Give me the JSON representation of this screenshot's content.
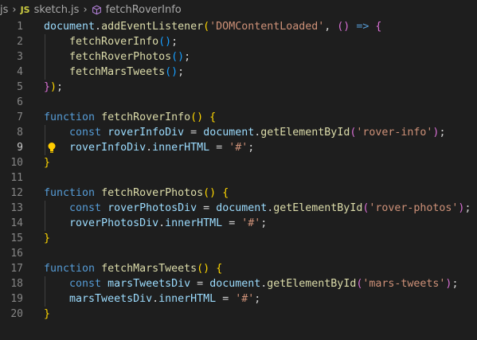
{
  "breadcrumb": {
    "folder": "js",
    "file_badge": "JS",
    "file": "sketch.js",
    "symbol": "fetchRoverInfo",
    "separator_icon": "chevron-right-icon",
    "symbol_icon": "method-cube-icon"
  },
  "editor": {
    "active_line": 9,
    "colors": {
      "background": "#1e1e1e",
      "keyword": "#569cd6",
      "function": "#dcdcaa",
      "variable": "#9cdcfe",
      "string": "#ce9178",
      "bracket_gold": "#ffd700",
      "bracket_orchid": "#da70d6",
      "bracket_blue": "#179fff"
    },
    "lines": [
      {
        "n": "1",
        "t": [
          [
            "var",
            "document"
          ],
          [
            "pun",
            "."
          ],
          [
            "fn",
            "addEventListener"
          ],
          [
            "br1",
            "("
          ],
          [
            "str",
            "'DOMContentLoaded'"
          ],
          [
            "pun",
            ", "
          ],
          [
            "br2",
            "()"
          ],
          [
            "kw",
            " => "
          ],
          [
            "br2",
            "{"
          ]
        ]
      },
      {
        "n": "2",
        "t": [
          [
            "pun",
            "    "
          ],
          [
            "fn",
            "fetchRoverInfo"
          ],
          [
            "br3",
            "()"
          ],
          [
            "pun",
            ";"
          ]
        ]
      },
      {
        "n": "3",
        "t": [
          [
            "pun",
            "    "
          ],
          [
            "fn",
            "fetchRoverPhotos"
          ],
          [
            "br3",
            "()"
          ],
          [
            "pun",
            ";"
          ]
        ]
      },
      {
        "n": "4",
        "t": [
          [
            "pun",
            "    "
          ],
          [
            "fn",
            "fetchMarsTweets"
          ],
          [
            "br3",
            "()"
          ],
          [
            "pun",
            ";"
          ]
        ]
      },
      {
        "n": "5",
        "t": [
          [
            "br2",
            "}"
          ],
          [
            "br1",
            ")"
          ],
          [
            "pun",
            ";"
          ]
        ]
      },
      {
        "n": "6",
        "t": []
      },
      {
        "n": "7",
        "t": [
          [
            "kw",
            "function"
          ],
          [
            "pun",
            " "
          ],
          [
            "fn",
            "fetchRoverInfo"
          ],
          [
            "br1",
            "()"
          ],
          [
            "pun",
            " "
          ],
          [
            "br1",
            "{"
          ]
        ]
      },
      {
        "n": "8",
        "t": [
          [
            "pun",
            "    "
          ],
          [
            "kw",
            "const"
          ],
          [
            "pun",
            " "
          ],
          [
            "var",
            "roverInfoDiv"
          ],
          [
            "pun",
            " = "
          ],
          [
            "var",
            "document"
          ],
          [
            "pun",
            "."
          ],
          [
            "fn",
            "getElementById"
          ],
          [
            "br2",
            "("
          ],
          [
            "str",
            "'rover-info'"
          ],
          [
            "br2",
            ")"
          ],
          [
            "pun",
            ";"
          ]
        ]
      },
      {
        "n": "9",
        "t": [
          [
            "pun",
            "    "
          ],
          [
            "var",
            "roverInfoDiv"
          ],
          [
            "pun",
            "."
          ],
          [
            "var",
            "innerHTML"
          ],
          [
            "pun",
            " = "
          ],
          [
            "str",
            "'#'"
          ],
          [
            "pun",
            ";"
          ]
        ]
      },
      {
        "n": "10",
        "t": [
          [
            "br1",
            "}"
          ]
        ]
      },
      {
        "n": "11",
        "t": []
      },
      {
        "n": "12",
        "t": [
          [
            "kw",
            "function"
          ],
          [
            "pun",
            " "
          ],
          [
            "fn",
            "fetchRoverPhotos"
          ],
          [
            "br1",
            "()"
          ],
          [
            "pun",
            " "
          ],
          [
            "br1",
            "{"
          ]
        ]
      },
      {
        "n": "13",
        "t": [
          [
            "pun",
            "    "
          ],
          [
            "kw",
            "const"
          ],
          [
            "pun",
            " "
          ],
          [
            "var",
            "roverPhotosDiv"
          ],
          [
            "pun",
            " = "
          ],
          [
            "var",
            "document"
          ],
          [
            "pun",
            "."
          ],
          [
            "fn",
            "getElementById"
          ],
          [
            "br2",
            "("
          ],
          [
            "str",
            "'rover-photos'"
          ],
          [
            "br2",
            ")"
          ],
          [
            "pun",
            ";"
          ]
        ]
      },
      {
        "n": "14",
        "t": [
          [
            "pun",
            "    "
          ],
          [
            "var",
            "roverPhotosDiv"
          ],
          [
            "pun",
            "."
          ],
          [
            "var",
            "innerHTML"
          ],
          [
            "pun",
            " = "
          ],
          [
            "str",
            "'#'"
          ],
          [
            "pun",
            ";"
          ]
        ]
      },
      {
        "n": "15",
        "t": [
          [
            "br1",
            "}"
          ]
        ]
      },
      {
        "n": "16",
        "t": []
      },
      {
        "n": "17",
        "t": [
          [
            "kw",
            "function"
          ],
          [
            "pun",
            " "
          ],
          [
            "fn",
            "fetchMarsTweets"
          ],
          [
            "br1",
            "()"
          ],
          [
            "pun",
            " "
          ],
          [
            "br1",
            "{"
          ]
        ]
      },
      {
        "n": "18",
        "t": [
          [
            "pun",
            "    "
          ],
          [
            "kw",
            "const"
          ],
          [
            "pun",
            " "
          ],
          [
            "var",
            "marsTweetsDiv"
          ],
          [
            "pun",
            " = "
          ],
          [
            "var",
            "document"
          ],
          [
            "pun",
            "."
          ],
          [
            "fn",
            "getElementById"
          ],
          [
            "br2",
            "("
          ],
          [
            "str",
            "'mars-tweets'"
          ],
          [
            "br2",
            ")"
          ],
          [
            "pun",
            ";"
          ]
        ]
      },
      {
        "n": "19",
        "t": [
          [
            "pun",
            "    "
          ],
          [
            "var",
            "marsTweetsDiv"
          ],
          [
            "pun",
            "."
          ],
          [
            "var",
            "innerHTML"
          ],
          [
            "pun",
            " = "
          ],
          [
            "str",
            "'#'"
          ],
          [
            "pun",
            ";"
          ]
        ]
      },
      {
        "n": "20",
        "t": [
          [
            "br1",
            "}"
          ]
        ]
      }
    ],
    "lightbulb_line": 9,
    "lightbulb_icon": "lightbulb-icon"
  }
}
